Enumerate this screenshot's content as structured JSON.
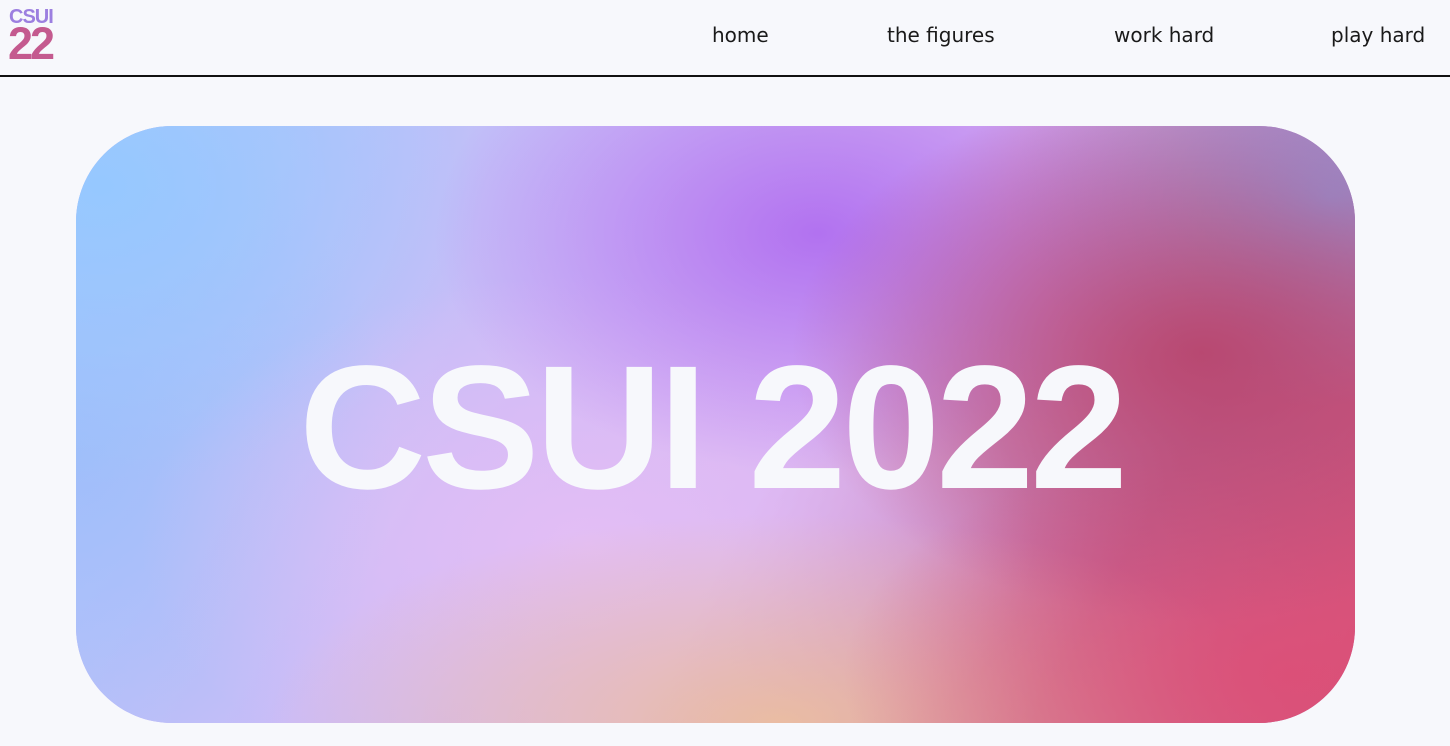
{
  "logo": {
    "top_text": "CSUI",
    "bottom_text": "22"
  },
  "nav": {
    "items": [
      {
        "label": "home"
      },
      {
        "label": "the figures"
      },
      {
        "label": "work hard"
      },
      {
        "label": "play hard"
      }
    ]
  },
  "hero": {
    "title": "CSUI 2022"
  },
  "colors": {
    "page_background": "#f7f8fc",
    "logo_top": "#9c7fe0",
    "logo_bottom": "#c45a8f",
    "nav_text": "#1a1a1a",
    "header_border": "#111111",
    "hero_title": "#f7f8fc"
  }
}
